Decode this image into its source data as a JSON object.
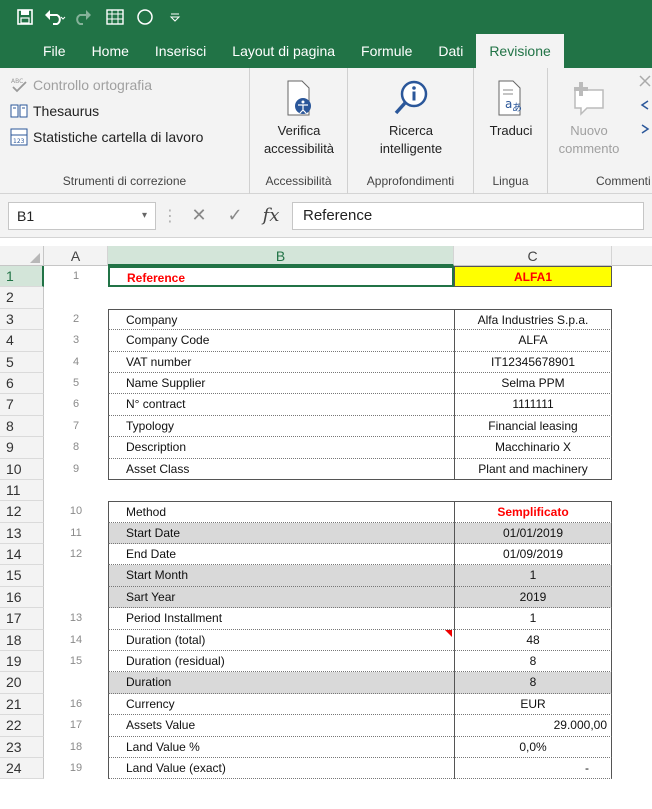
{
  "ribbon": {
    "tabs": [
      {
        "label": "File",
        "active": false
      },
      {
        "label": "Home",
        "active": false
      },
      {
        "label": "Inserisci",
        "active": false
      },
      {
        "label": "Layout di pagina",
        "active": false
      },
      {
        "label": "Formule",
        "active": false
      },
      {
        "label": "Dati",
        "active": false
      },
      {
        "label": "Revisione",
        "active": true
      }
    ],
    "proofing": {
      "spelling": "Controllo ortografia",
      "thesaurus": "Thesaurus",
      "stats": "Statistiche cartella di lavoro",
      "label": "Strumenti di correzione"
    },
    "accessibility": {
      "line1": "Verifica",
      "line2": "accessibilità",
      "label": "Accessibilità"
    },
    "insights": {
      "line1": "Ricerca",
      "line2": "intelligente",
      "label": "Approfondimenti"
    },
    "language": {
      "line1": "Traduci",
      "label": "Lingua"
    },
    "comments": {
      "line1": "Nuovo",
      "line2": "commento",
      "label": "Commenti"
    }
  },
  "formula_bar": {
    "name_box": "B1",
    "fx": "fx",
    "content": "Reference"
  },
  "columns": [
    "A",
    "B",
    "C"
  ],
  "rows": [
    {
      "n": "1",
      "a": "1",
      "b": "Reference",
      "c": "ALFA1"
    },
    {
      "n": "2",
      "a": "",
      "b": "",
      "c": ""
    },
    {
      "n": "3",
      "a": "2",
      "b": "Company",
      "c": "Alfa Industries S.p.a."
    },
    {
      "n": "4",
      "a": "3",
      "b": "Company Code",
      "c": "ALFA"
    },
    {
      "n": "5",
      "a": "4",
      "b": "VAT number",
      "c": "IT12345678901"
    },
    {
      "n": "6",
      "a": "5",
      "b": "Name Supplier",
      "c": "Selma PPM"
    },
    {
      "n": "7",
      "a": "6",
      "b": "N° contract",
      "c": "1111111"
    },
    {
      "n": "8",
      "a": "7",
      "b": "Typology",
      "c": "Financial leasing"
    },
    {
      "n": "9",
      "a": "8",
      "b": "Description",
      "c": "Macchinario X"
    },
    {
      "n": "10",
      "a": "9",
      "b": "Asset Class",
      "c": "Plant and machinery"
    },
    {
      "n": "11",
      "a": "",
      "b": "",
      "c": ""
    },
    {
      "n": "12",
      "a": "10",
      "b": "Method",
      "c": "Semplificato"
    },
    {
      "n": "13",
      "a": "11",
      "b": "Start Date",
      "c": "01/01/2019"
    },
    {
      "n": "14",
      "a": "12",
      "b": "End Date",
      "c": "01/09/2019"
    },
    {
      "n": "15",
      "a": "",
      "b": "Start Month",
      "c": "1"
    },
    {
      "n": "16",
      "a": "",
      "b": "Sart Year",
      "c": "2019"
    },
    {
      "n": "17",
      "a": "13",
      "b": "Period Installment",
      "c": "1"
    },
    {
      "n": "18",
      "a": "14",
      "b": "Duration (total)",
      "c": "48"
    },
    {
      "n": "19",
      "a": "15",
      "b": "Duration (residual)",
      "c": "8"
    },
    {
      "n": "20",
      "a": "",
      "b": "Duration",
      "c": "8"
    },
    {
      "n": "21",
      "a": "16",
      "b": "Currency",
      "c": "EUR"
    },
    {
      "n": "22",
      "a": "17",
      "b": "Assets Value",
      "c": "29.000,00"
    },
    {
      "n": "23",
      "a": "18",
      "b": "Land Value %",
      "c": "0,0%"
    },
    {
      "n": "24",
      "a": "19",
      "b": "Land Value (exact)",
      "c": "-"
    }
  ],
  "colors": {
    "excel_green": "#217346",
    "highlight_yellow": "#ffff00",
    "alert_red": "#ff0000"
  }
}
